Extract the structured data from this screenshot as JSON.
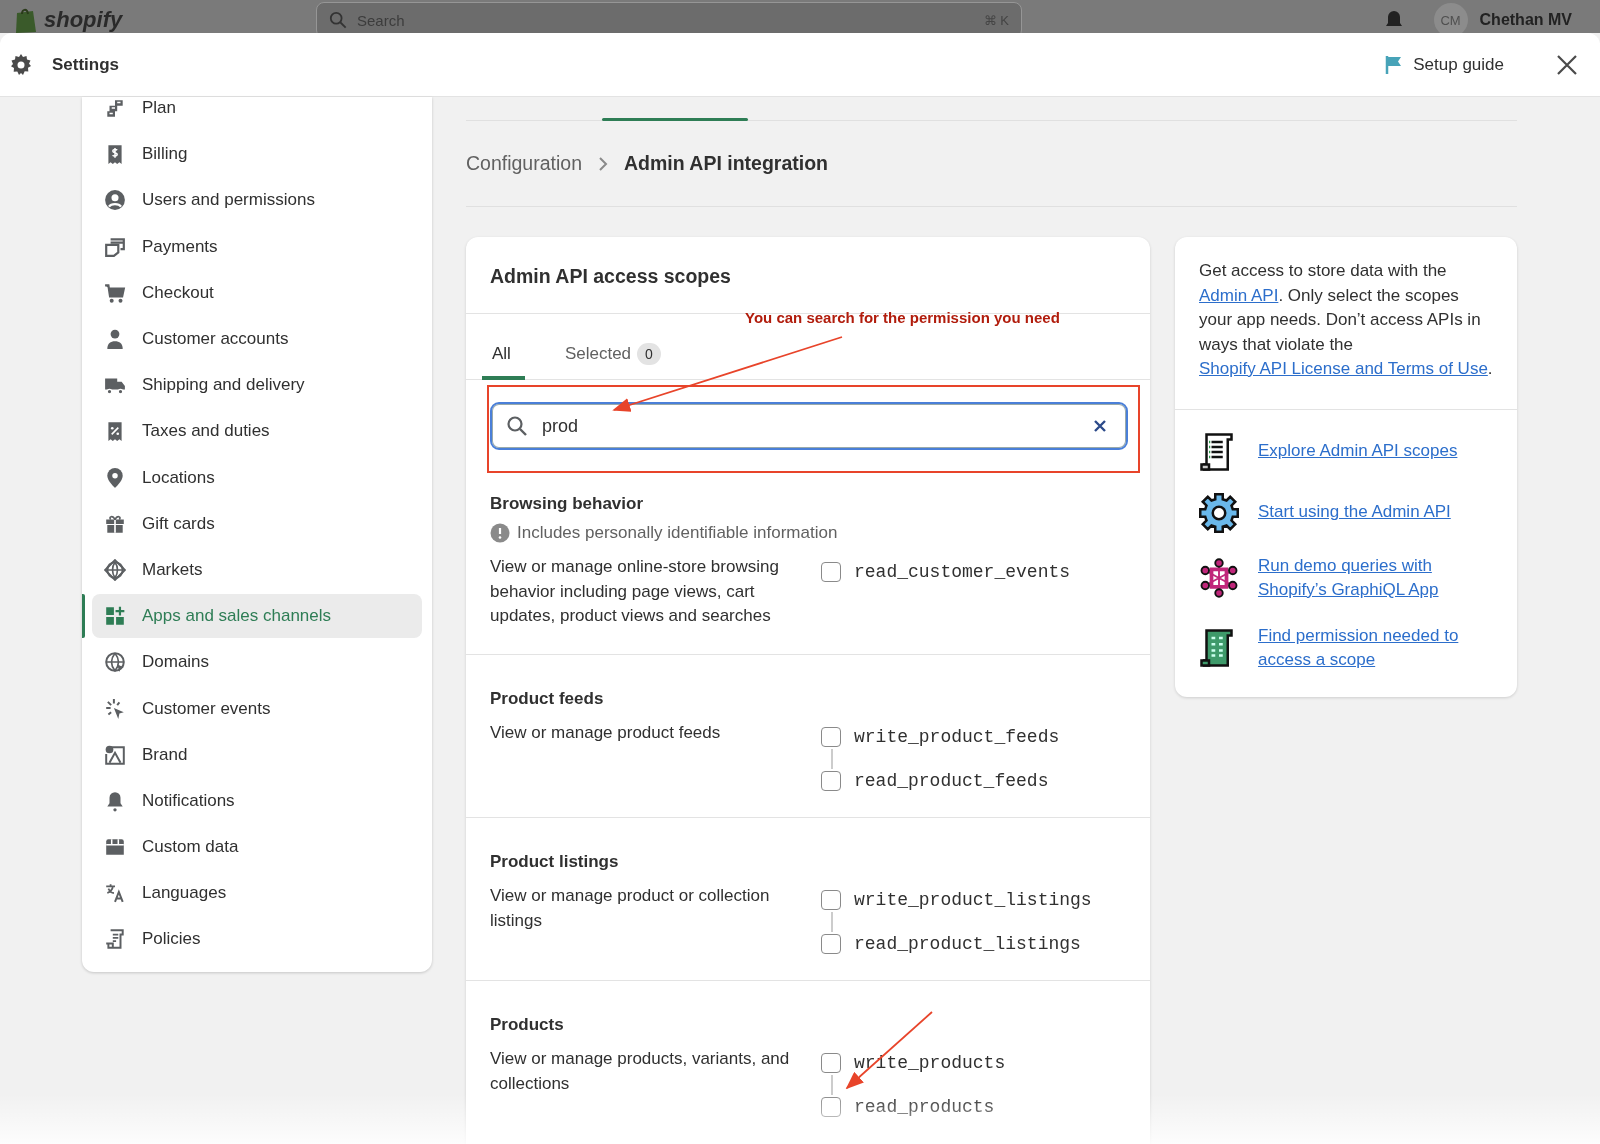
{
  "top_bar": {
    "logo": "shopify",
    "search": {
      "placeholder": "Search",
      "shortcut": "⌘ K"
    },
    "avatar": "CM",
    "user": "Chethan MV"
  },
  "header": {
    "title": "Settings",
    "setup_guide": "Setup guide"
  },
  "sidebar": {
    "items": [
      {
        "label": "Plan",
        "selected": false
      },
      {
        "label": "Billing",
        "selected": false
      },
      {
        "label": "Users and permissions",
        "selected": false
      },
      {
        "label": "Payments",
        "selected": false
      },
      {
        "label": "Checkout",
        "selected": false
      },
      {
        "label": "Customer accounts",
        "selected": false
      },
      {
        "label": "Shipping and delivery",
        "selected": false
      },
      {
        "label": "Taxes and duties",
        "selected": false
      },
      {
        "label": "Locations",
        "selected": false
      },
      {
        "label": "Gift cards",
        "selected": false
      },
      {
        "label": "Markets",
        "selected": false
      },
      {
        "label": "Apps and sales channels",
        "selected": true
      },
      {
        "label": "Domains",
        "selected": false
      },
      {
        "label": "Customer events",
        "selected": false
      },
      {
        "label": "Brand",
        "selected": false
      },
      {
        "label": "Notifications",
        "selected": false
      },
      {
        "label": "Custom data",
        "selected": false
      },
      {
        "label": "Languages",
        "selected": false
      },
      {
        "label": "Policies",
        "selected": false
      }
    ]
  },
  "breadcrumb": [
    "Configuration",
    "Admin API integration"
  ],
  "scopes_card": {
    "title": "Admin API access scopes",
    "tabs": [
      {
        "label": "All",
        "selected": true
      },
      {
        "label": "Selected",
        "count": "0",
        "selected": false
      }
    ],
    "search": {
      "value": "prod"
    },
    "sections": [
      {
        "title": "Browsing behavior",
        "note": "Includes personally identifiable information",
        "description": "View or manage online-store browsing behavior including page views, cart updates, product views and searches",
        "scopes": [
          {
            "name": "read_customer_events",
            "checked": false
          }
        ]
      },
      {
        "title": "Product feeds",
        "description": "View or manage product feeds",
        "scopes": [
          {
            "name": "write_product_feeds",
            "checked": false
          },
          {
            "name": "read_product_feeds",
            "checked": false
          }
        ]
      },
      {
        "title": "Product listings",
        "description": "View or manage product or collection listings",
        "scopes": [
          {
            "name": "write_product_listings",
            "checked": false
          },
          {
            "name": "read_product_listings",
            "checked": false
          }
        ]
      },
      {
        "title": "Products",
        "description": "View or manage products, variants, and collections",
        "scopes": [
          {
            "name": "write_products",
            "checked": false
          },
          {
            "name": "read_products",
            "checked": false
          }
        ]
      }
    ]
  },
  "help_card": {
    "intro": [
      {
        "text": "Get access to store data with the "
      },
      {
        "link": "Admin API"
      },
      {
        "text": ". Only select the scopes your app needs. Don’t access APIs in ways that violate the "
      },
      {
        "link": "Shopify API License and Terms of Use"
      },
      {
        "text": "."
      }
    ],
    "links": [
      {
        "label": "Explore Admin API scopes"
      },
      {
        "label": "Start using the Admin API"
      },
      {
        "label": "Run demo queries with Shopify’s GraphiQL App"
      },
      {
        "label": "Find permission needed to access a scope"
      }
    ]
  },
  "annotations": [
    {
      "text": "You can search for the permission you need"
    }
  ]
}
